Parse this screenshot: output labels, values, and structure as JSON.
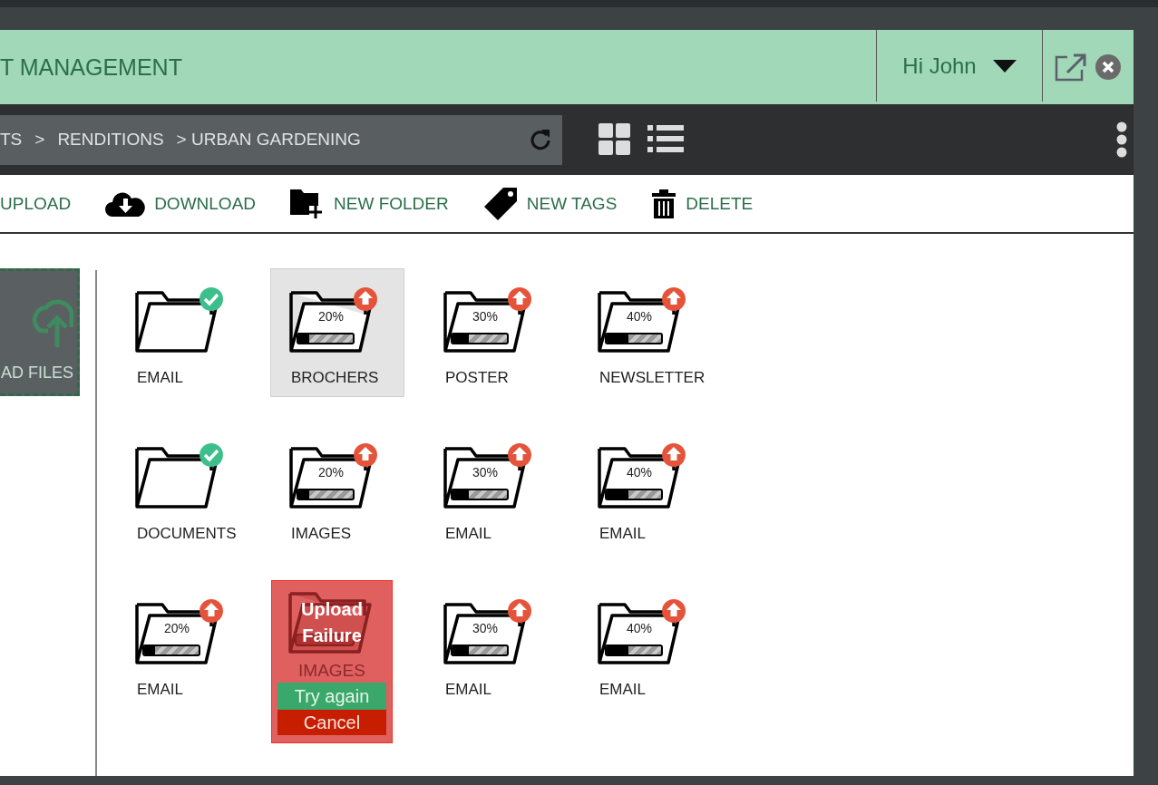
{
  "header": {
    "title": "T MANAGEMENT",
    "user": "Hi John"
  },
  "breadcrumb": [
    "TS",
    ">",
    "RENDITIONS",
    "> URBAN GARDENING"
  ],
  "actions": [
    {
      "kind": "upload",
      "label": "UPLOAD"
    },
    {
      "kind": "download",
      "label": "DOWNLOAD"
    },
    {
      "kind": "new-folder",
      "label": "NEW FOLDER"
    },
    {
      "kind": "tag",
      "label": "NEW TAGS"
    },
    {
      "kind": "delete",
      "label": "DELETE"
    }
  ],
  "dropzone": {
    "label": "AD FILES"
  },
  "folders": [
    {
      "kind": "done",
      "name": "EMAIL",
      "selected": false
    },
    {
      "kind": "uploading",
      "name": "BROCHERS",
      "progress": "20%",
      "level": 0.2,
      "selected": true
    },
    {
      "kind": "uploading",
      "name": "POSTER",
      "progress": "30%",
      "level": 0.3,
      "selected": false
    },
    {
      "kind": "uploading",
      "name": "NEWSLETTER",
      "progress": "40%",
      "level": 0.4,
      "selected": false
    },
    {
      "kind": "done",
      "name": "DOCUMENTS",
      "selected": false
    },
    {
      "kind": "uploading",
      "name": "IMAGES",
      "progress": "20%",
      "level": 0.2,
      "selected": false
    },
    {
      "kind": "uploading",
      "name": "EMAIL",
      "progress": "30%",
      "level": 0.3,
      "selected": false
    },
    {
      "kind": "uploading",
      "name": "EMAIL",
      "progress": "40%",
      "level": 0.4,
      "selected": false
    },
    {
      "kind": "uploading",
      "name": "EMAIL",
      "progress": "20%",
      "level": 0.2,
      "selected": false
    },
    {
      "kind": "failed",
      "name": "IMAGES",
      "message": "Upload Failure",
      "retry": "Try again",
      "cancel": "Cancel",
      "selected": false
    },
    {
      "kind": "uploading",
      "name": "EMAIL",
      "progress": "30%",
      "level": 0.3,
      "selected": false
    },
    {
      "kind": "uploading",
      "name": "EMAIL",
      "progress": "40%",
      "level": 0.4,
      "selected": false
    }
  ]
}
